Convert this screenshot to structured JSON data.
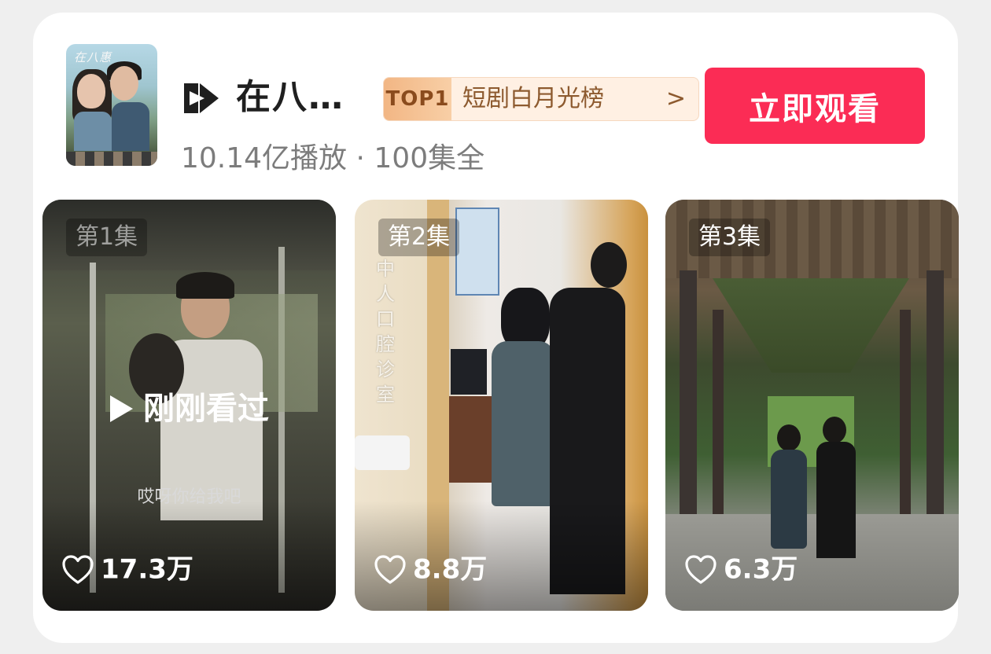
{
  "drama": {
    "title": "在八…",
    "poster_scrawl": "在八惠",
    "stats": "10.14亿播放 · 100集全",
    "brand_icon": "play-logo-icon"
  },
  "rank_badge": {
    "tag": "TOP1",
    "label": "短剧白月光榜",
    "chevron": ">"
  },
  "watch_button": {
    "label": "立即观看"
  },
  "episodes": [
    {
      "label": "第1集",
      "likes": "17.3万",
      "resume_text": "刚刚看过",
      "subtitle": "哎呀你给我吧"
    },
    {
      "label": "第2集",
      "likes": "8.8万",
      "sign_text": "中人口腔诊室"
    },
    {
      "label": "第3集",
      "likes": "6.3万"
    }
  ],
  "colors": {
    "accent": "#fb2c55",
    "badge_bg": "#fff0e3",
    "badge_text": "#8d5a2f",
    "stats_text": "#7c7c7c"
  },
  "icons": [
    "heart-outline-icon",
    "play-triangle-icon",
    "chevron-right-icon"
  ]
}
